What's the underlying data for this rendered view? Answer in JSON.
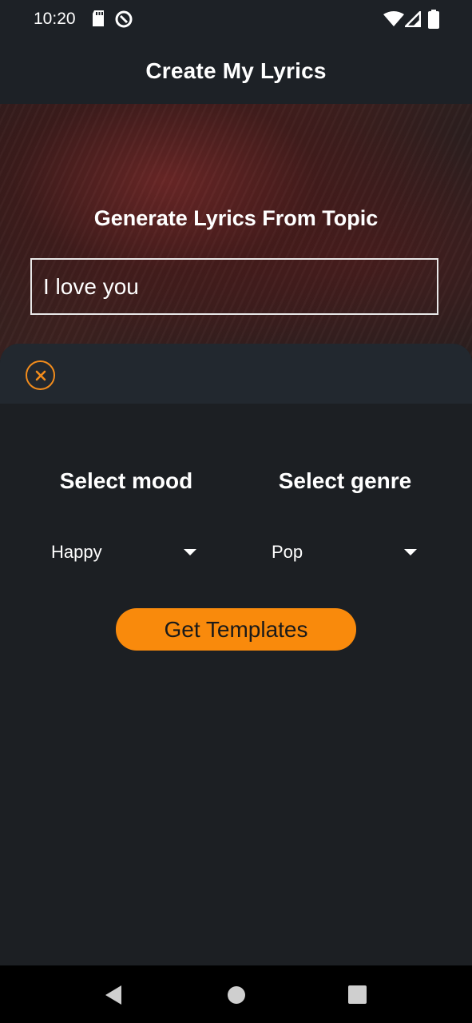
{
  "status_bar": {
    "time": "10:20",
    "icons": [
      "sd-card-icon",
      "data-saver-icon",
      "wifi-icon",
      "signal-icon",
      "battery-icon"
    ]
  },
  "app_bar": {
    "title": "Create My Lyrics"
  },
  "hero": {
    "title": "Generate Lyrics From Topic",
    "topic_value": "I love you"
  },
  "sheet": {
    "close_icon": "close-circle-icon",
    "mood": {
      "label": "Select mood",
      "selected": "Happy"
    },
    "genre": {
      "label": "Select genre",
      "selected": "Pop"
    },
    "button_label": "Get Templates"
  },
  "nav": {
    "buttons": [
      "back-icon",
      "home-icon",
      "recents-icon"
    ]
  },
  "colors": {
    "accent": "#f98a0c",
    "background": "#1c1f23",
    "bar": "#1d2126"
  }
}
